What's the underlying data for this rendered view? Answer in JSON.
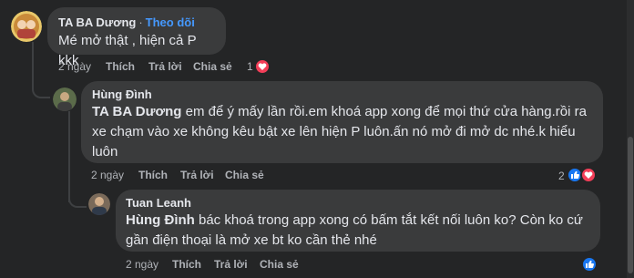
{
  "comments": [
    {
      "author": "TA BA Dương",
      "follow_label": "Theo dõi",
      "separator": "·",
      "text": "Mé mở thật , hiện cả P kkk",
      "time": "2 ngày",
      "like_label": "Thích",
      "reply_label": "Trả lời",
      "share_label": "Chia sẻ",
      "reaction_count": "1",
      "reactions": [
        "heart-icon"
      ]
    },
    {
      "author": "Hùng Đình",
      "mention": "TA BA Dương",
      "text_line1": " em để ý mấy lần rồi.em khoá app xong để mọi thứ cửa hàng.rồi ra",
      "text_line2": "xe chạm vào xe không kêu bật xe lên hiện P luôn.ấn nó mở đi mở dc nhé.k hiểu",
      "text_line3": "luôn",
      "time": "2 ngày",
      "like_label": "Thích",
      "reply_label": "Trả lời",
      "share_label": "Chia sẻ",
      "reaction_count": "2",
      "reactions": [
        "like-icon",
        "heart-icon"
      ]
    },
    {
      "author": "Tuan Leanh",
      "mention": "Hùng Đình",
      "text_line1": " bác khoá trong app xong có bấm tắt kết nối luôn ko? Còn ko cứ",
      "text_line2": "gần điện thoại là mở xe bt ko cần thẻ nhé",
      "time": "2 ngày",
      "like_label": "Thích",
      "reply_label": "Trả lời",
      "share_label": "Chia sẻ",
      "reactions": [
        "like-icon"
      ]
    }
  ],
  "colors": {
    "background": "#242526",
    "bubble": "#3a3b3c",
    "text": "#e4e6eb",
    "meta": "#b0b3b8",
    "link": "#4599ff",
    "like_blue": "#1877f2",
    "heart_red": "#f33e58"
  }
}
